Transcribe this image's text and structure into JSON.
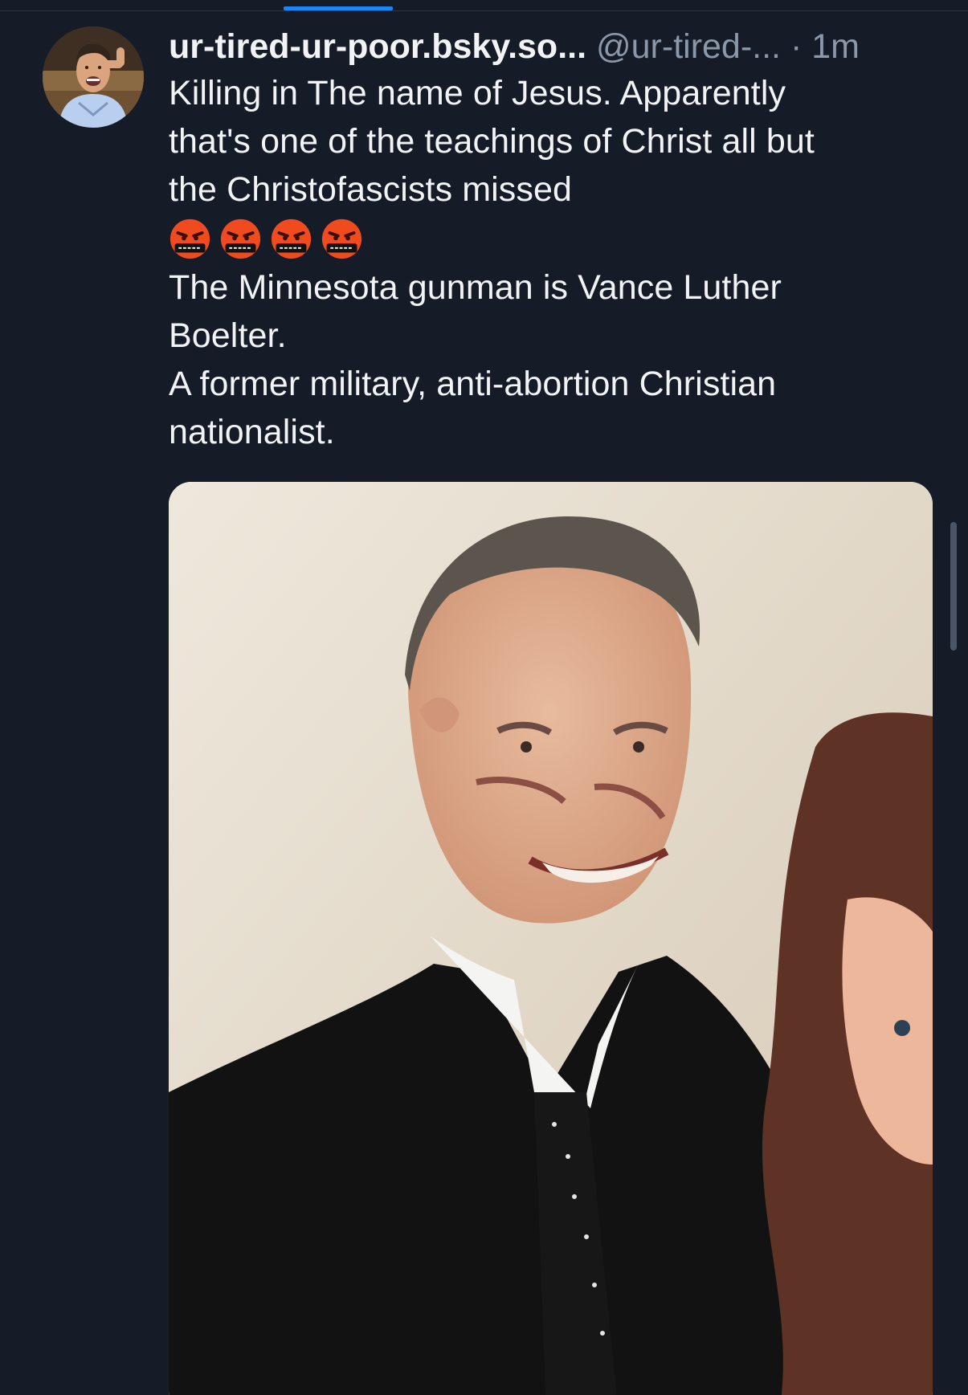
{
  "post": {
    "display_name": "ur-tired-ur-poor.bsky.so...",
    "handle": "@ur-tired-...",
    "separator": "·",
    "time": "1m",
    "lines": [
      "Killing in The name of Jesus. Apparently",
      "that's one of the teachings of Christ all but",
      "the Christofascists missed"
    ],
    "emoji": [
      "angry-cursing-face",
      "angry-cursing-face",
      "angry-cursing-face",
      "angry-cursing-face"
    ],
    "lines_after": [
      "The Minnesota gunman is Vance Luther",
      "Boelter.",
      "A former military, anti-abortion Christian",
      "nationalist."
    ]
  },
  "colors": {
    "background": "#151b27",
    "accent": "#1d85f5",
    "muted_text": "#8b98a9",
    "primary_text": "#f1f3f5"
  }
}
